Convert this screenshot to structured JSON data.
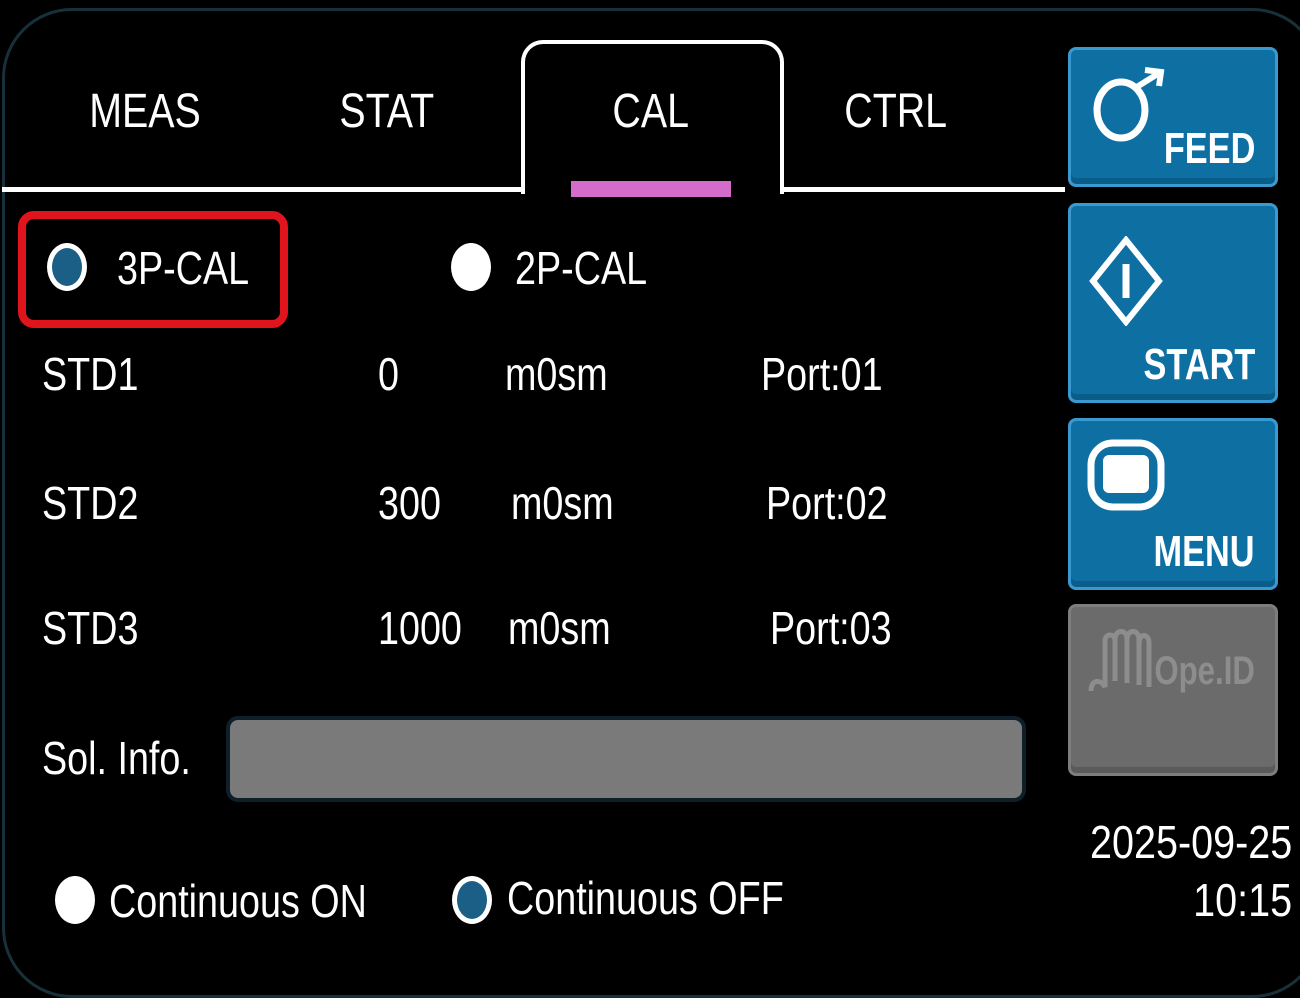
{
  "tabs": [
    {
      "label": "MEAS",
      "active": false
    },
    {
      "label": "STAT",
      "active": false
    },
    {
      "label": "CAL",
      "active": true
    },
    {
      "label": "CTRL",
      "active": false
    }
  ],
  "cal_mode": {
    "options": [
      {
        "label": "3P-CAL",
        "selected": true
      },
      {
        "label": "2P-CAL",
        "selected": false
      }
    ]
  },
  "standards": [
    {
      "name": "STD1",
      "value": "0",
      "unit": "m0sm",
      "port": "Port:01"
    },
    {
      "name": "STD2",
      "value": "300",
      "unit": "m0sm",
      "port": "Port:02"
    },
    {
      "name": "STD3",
      "value": "1000",
      "unit": "m0sm",
      "port": "Port:03"
    }
  ],
  "sol_info": {
    "label": "Sol. Info.",
    "value": ""
  },
  "continuous": {
    "options": [
      {
        "label": "Continuous ON",
        "selected": false
      },
      {
        "label": "Continuous OFF",
        "selected": true
      }
    ]
  },
  "side_buttons": [
    {
      "label": "FEED",
      "icon": "feed-icon",
      "enabled": true
    },
    {
      "label": "START",
      "icon": "start-diamond-icon",
      "enabled": true
    },
    {
      "label": "MENU",
      "icon": "menu-screen-icon",
      "enabled": true
    },
    {
      "label": "Ope.ID",
      "icon": "operator-hand-icon",
      "enabled": false
    }
  ],
  "datetime": {
    "date": "2025-09-25",
    "time": "10:15"
  },
  "colors": {
    "accent_blue": "#0e6fa3",
    "radio_selected": "#1b5f86",
    "tab_indicator": "#d56ccc",
    "highlight_red": "#e0141c",
    "disabled_gray": "#6b6b6b"
  }
}
